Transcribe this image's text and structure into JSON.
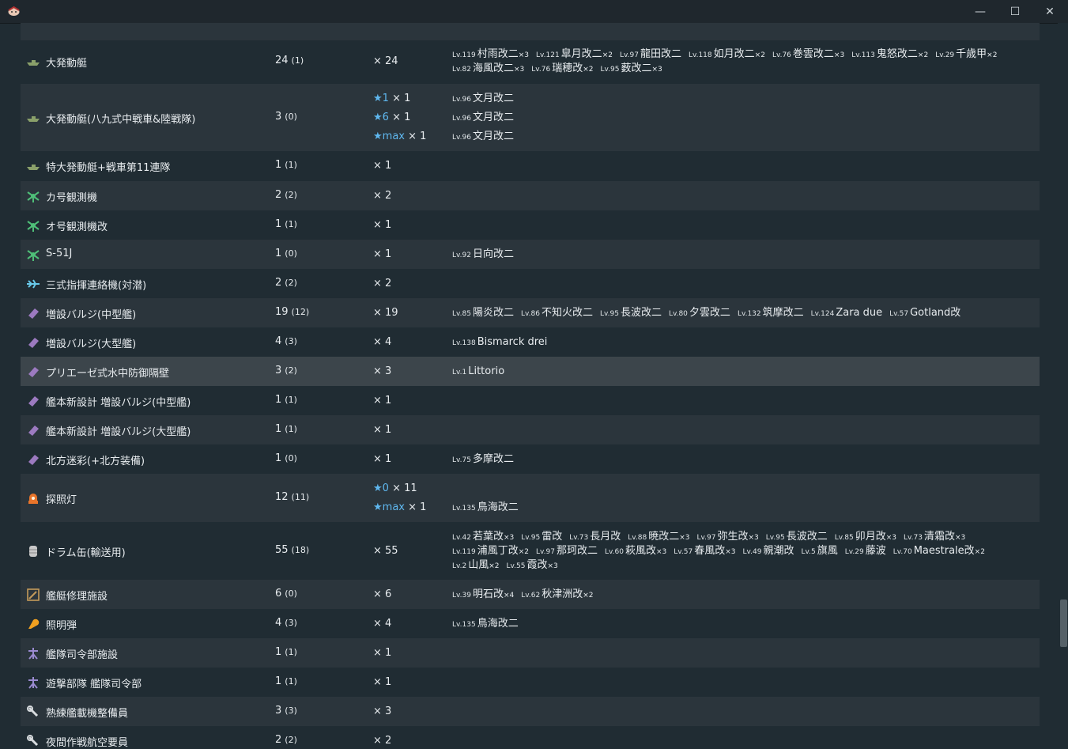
{
  "window": {
    "minimize": "—",
    "maximize": "☐",
    "close": "✕"
  },
  "rows": [
    {
      "name": "大発動艇",
      "count": "24",
      "count_sub": "(1)",
      "qty": [
        {
          "star": "",
          "text": "× 24"
        }
      ],
      "ships": [
        [
          {
            "lv": "Lv.119",
            "name": "村雨改二",
            "mult": "×3"
          },
          {
            "lv": "Lv.121",
            "name": "皐月改二",
            "mult": "×2"
          },
          {
            "lv": "Lv.97",
            "name": "龍田改二",
            "mult": ""
          },
          {
            "lv": "Lv.118",
            "name": "如月改二",
            "mult": "×2"
          },
          {
            "lv": "Lv.76",
            "name": "巻雲改二",
            "mult": "×3"
          },
          {
            "lv": "Lv.113",
            "name": "鬼怒改二",
            "mult": "×2"
          },
          {
            "lv": "Lv.29",
            "name": "千歳甲",
            "mult": "×2"
          }
        ],
        [
          {
            "lv": "Lv.82",
            "name": "海風改二",
            "mult": "×3"
          },
          {
            "lv": "Lv.76",
            "name": "瑞穂改",
            "mult": "×2"
          },
          {
            "lv": "Lv.95",
            "name": "薮改二",
            "mult": "×3"
          }
        ]
      ]
    },
    {
      "name": "大発動艇(八九式中戦車&陸戦隊)",
      "count": "3",
      "count_sub": "(0)",
      "qty": [
        {
          "star": "★1",
          "text": " × 1"
        },
        {
          "star": "★6",
          "text": " × 1"
        },
        {
          "star": "★max",
          "text": " × 1"
        }
      ],
      "ships": [
        [
          {
            "lv": "Lv.96",
            "name": "文月改二",
            "mult": ""
          }
        ],
        [
          {
            "lv": "Lv.96",
            "name": "文月改二",
            "mult": ""
          }
        ],
        [
          {
            "lv": "Lv.96",
            "name": "文月改二",
            "mult": ""
          }
        ]
      ]
    },
    {
      "name": "特大発動艇+戦車第11連隊",
      "count": "1",
      "count_sub": "(1)",
      "qty": [
        {
          "star": "",
          "text": "× 1"
        }
      ],
      "ships": []
    },
    {
      "name": "カ号観測機",
      "count": "2",
      "count_sub": "(2)",
      "qty": [
        {
          "star": "",
          "text": "× 2"
        }
      ],
      "ships": []
    },
    {
      "name": "オ号観測機改",
      "count": "1",
      "count_sub": "(1)",
      "qty": [
        {
          "star": "",
          "text": "× 1"
        }
      ],
      "ships": []
    },
    {
      "name": "S-51J",
      "count": "1",
      "count_sub": "(0)",
      "qty": [
        {
          "star": "",
          "text": "× 1"
        }
      ],
      "ships": [
        [
          {
            "lv": "Lv.92",
            "name": "日向改二",
            "mult": ""
          }
        ]
      ]
    },
    {
      "name": "三式指揮連絡機(対潜)",
      "count": "2",
      "count_sub": "(2)",
      "qty": [
        {
          "star": "",
          "text": "× 2"
        }
      ],
      "ships": []
    },
    {
      "name": "増設バルジ(中型艦)",
      "count": "19",
      "count_sub": "(12)",
      "qty": [
        {
          "star": "",
          "text": "× 19"
        }
      ],
      "ships": [
        [
          {
            "lv": "Lv.85",
            "name": "陽炎改二",
            "mult": ""
          },
          {
            "lv": "Lv.86",
            "name": "不知火改二",
            "mult": ""
          },
          {
            "lv": "Lv.95",
            "name": "長波改二",
            "mult": ""
          },
          {
            "lv": "Lv.80",
            "name": "夕雲改二",
            "mult": ""
          },
          {
            "lv": "Lv.132",
            "name": "筑摩改二",
            "mult": ""
          },
          {
            "lv": "Lv.124",
            "name": "Zara due",
            "mult": ""
          },
          {
            "lv": "Lv.57",
            "name": "Gotland改",
            "mult": ""
          }
        ]
      ]
    },
    {
      "name": "増設バルジ(大型艦)",
      "count": "4",
      "count_sub": "(3)",
      "qty": [
        {
          "star": "",
          "text": "× 4"
        }
      ],
      "ships": [
        [
          {
            "lv": "Lv.138",
            "name": "Bismarck drei",
            "mult": ""
          }
        ]
      ]
    },
    {
      "name": "プリエーゼ式水中防御隔壁",
      "count": "3",
      "count_sub": "(2)",
      "qty": [
        {
          "star": "",
          "text": "× 3"
        }
      ],
      "ships": [
        [
          {
            "lv": "Lv.1",
            "name": "Littorio",
            "mult": ""
          }
        ]
      ]
    },
    {
      "name": "艦本新設計 増設バルジ(中型艦)",
      "count": "1",
      "count_sub": "(1)",
      "qty": [
        {
          "star": "",
          "text": "× 1"
        }
      ],
      "ships": []
    },
    {
      "name": "艦本新設計 増設バルジ(大型艦)",
      "count": "1",
      "count_sub": "(1)",
      "qty": [
        {
          "star": "",
          "text": "× 1"
        }
      ],
      "ships": []
    },
    {
      "name": "北方迷彩(+北方装備)",
      "count": "1",
      "count_sub": "(0)",
      "qty": [
        {
          "star": "",
          "text": "× 1"
        }
      ],
      "ships": [
        [
          {
            "lv": "Lv.75",
            "name": "多摩改二",
            "mult": ""
          }
        ]
      ]
    },
    {
      "name": "探照灯",
      "count": "12",
      "count_sub": "(11)",
      "qty": [
        {
          "star": "★0",
          "text": " × 11"
        },
        {
          "star": "★max",
          "text": " × 1"
        }
      ],
      "ships": [
        [],
        [
          {
            "lv": "Lv.135",
            "name": "鳥海改二",
            "mult": ""
          }
        ]
      ]
    },
    {
      "name": "ドラム缶(輸送用)",
      "count": "55",
      "count_sub": "(18)",
      "qty": [
        {
          "star": "",
          "text": "× 55"
        }
      ],
      "ships": [
        [
          {
            "lv": "Lv.42",
            "name": "若葉改",
            "mult": "×3"
          },
          {
            "lv": "Lv.95",
            "name": "雷改",
            "mult": ""
          },
          {
            "lv": "Lv.73",
            "name": "長月改",
            "mult": ""
          },
          {
            "lv": "Lv.88",
            "name": "暁改二",
            "mult": "×3"
          },
          {
            "lv": "Lv.97",
            "name": "弥生改",
            "mult": "×3"
          },
          {
            "lv": "Lv.95",
            "name": "長波改二",
            "mult": ""
          },
          {
            "lv": "Lv.85",
            "name": "卯月改",
            "mult": "×3"
          },
          {
            "lv": "Lv.73",
            "name": "清霜改",
            "mult": "×3"
          }
        ],
        [
          {
            "lv": "Lv.119",
            "name": "浦風丁改",
            "mult": "×2"
          },
          {
            "lv": "Lv.97",
            "name": "那珂改二",
            "mult": ""
          },
          {
            "lv": "Lv.60",
            "name": "萩風改",
            "mult": "×3"
          },
          {
            "lv": "Lv.57",
            "name": "春風改",
            "mult": "×3"
          },
          {
            "lv": "Lv.49",
            "name": "親潮改",
            "mult": ""
          },
          {
            "lv": "Lv.5",
            "name": "旗風",
            "mult": ""
          },
          {
            "lv": "Lv.29",
            "name": "藤波",
            "mult": ""
          },
          {
            "lv": "Lv.70",
            "name": "Maestrale改",
            "mult": "×2"
          }
        ],
        [
          {
            "lv": "Lv.2",
            "name": "山風",
            "mult": "×2"
          },
          {
            "lv": "Lv.55",
            "name": "霞改",
            "mult": "×3"
          }
        ]
      ]
    },
    {
      "name": "艦艇修理施設",
      "count": "6",
      "count_sub": "(0)",
      "qty": [
        {
          "star": "",
          "text": "× 6"
        }
      ],
      "ships": [
        [
          {
            "lv": "Lv.39",
            "name": "明石改",
            "mult": "×4"
          },
          {
            "lv": "Lv.62",
            "name": "秋津洲改",
            "mult": "×2"
          }
        ]
      ]
    },
    {
      "name": "照明弾",
      "count": "4",
      "count_sub": "(3)",
      "qty": [
        {
          "star": "",
          "text": "× 4"
        }
      ],
      "ships": [
        [
          {
            "lv": "Lv.135",
            "name": "鳥海改二",
            "mult": ""
          }
        ]
      ]
    },
    {
      "name": "艦隊司令部施設",
      "count": "1",
      "count_sub": "(1)",
      "qty": [
        {
          "star": "",
          "text": "× 1"
        }
      ],
      "ships": []
    },
    {
      "name": "遊撃部隊 艦隊司令部",
      "count": "1",
      "count_sub": "(1)",
      "qty": [
        {
          "star": "",
          "text": "× 1"
        }
      ],
      "ships": []
    },
    {
      "name": "熟練艦載機整備員",
      "count": "3",
      "count_sub": "(3)",
      "qty": [
        {
          "star": "",
          "text": "× 3"
        }
      ],
      "ships": []
    },
    {
      "name": "夜間作戦航空要員",
      "count": "2",
      "count_sub": "(2)",
      "qty": [
        {
          "star": "",
          "text": "× 2"
        }
      ],
      "ships": []
    }
  ]
}
